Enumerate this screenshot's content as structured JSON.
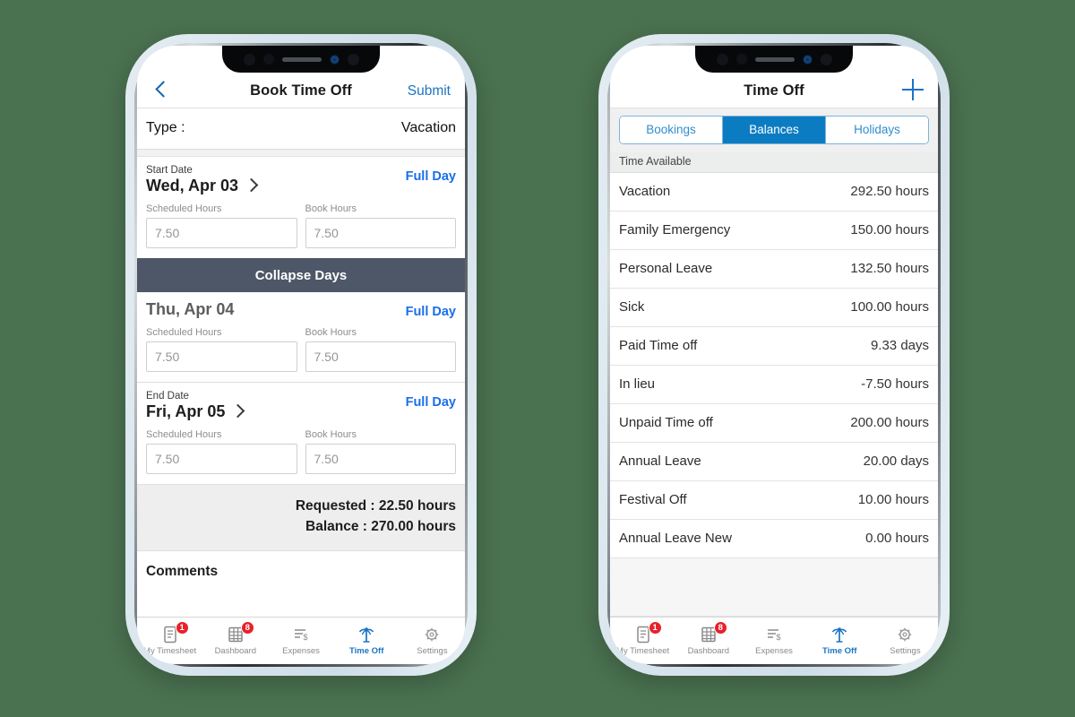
{
  "background_color": "#4a7150",
  "accent_blue": "#1a74c4",
  "link_blue": "#1a6ee8",
  "badge_red": "#e8202a",
  "collapse_bar_color": "#4e5767",
  "left_phone": {
    "appbar": {
      "back_icon": "chevron-left-icon",
      "title": "Book Time Off",
      "submit_label": "Submit"
    },
    "type_row": {
      "label": "Type :",
      "value": "Vacation"
    },
    "days": [
      {
        "caption": "Start Date",
        "date": "Wed, Apr 03",
        "has_chevron": true,
        "full_day_label": "Full Day",
        "scheduled_hours_label": "Scheduled Hours",
        "scheduled_hours_value": "7.50",
        "book_hours_label": "Book Hours",
        "book_hours_value": "7.50"
      },
      {
        "caption": "",
        "date": "Thu, Apr 04",
        "has_chevron": false,
        "full_day_label": "Full Day",
        "scheduled_hours_label": "Scheduled Hours",
        "scheduled_hours_value": "7.50",
        "book_hours_label": "Book Hours",
        "book_hours_value": "7.50"
      },
      {
        "caption": "End Date",
        "date": "Fri, Apr 05",
        "has_chevron": true,
        "full_day_label": "Full Day",
        "scheduled_hours_label": "Scheduled Hours",
        "scheduled_hours_value": "7.50",
        "book_hours_label": "Book Hours",
        "book_hours_value": "7.50"
      }
    ],
    "collapse_bar_label": "Collapse Days",
    "summary": {
      "requested": "Requested :  22.50 hours",
      "balance": "Balance :  270.00 hours"
    },
    "comments_label": "Comments"
  },
  "right_phone": {
    "appbar": {
      "title": "Time Off",
      "add_icon": "plus-icon"
    },
    "segments": [
      {
        "label": "Bookings",
        "active": false
      },
      {
        "label": "Balances",
        "active": true
      },
      {
        "label": "Holidays",
        "active": false
      }
    ],
    "list_header": "Time Available",
    "balances": [
      {
        "name": "Vacation",
        "value": "292.50 hours"
      },
      {
        "name": "Family Emergency",
        "value": "150.00 hours"
      },
      {
        "name": "Personal Leave",
        "value": "132.50 hours"
      },
      {
        "name": "Sick",
        "value": "100.00 hours"
      },
      {
        "name": "Paid Time off",
        "value": "9.33 days"
      },
      {
        "name": "In lieu",
        "value": "-7.50 hours"
      },
      {
        "name": "Unpaid Time off",
        "value": "200.00 hours"
      },
      {
        "name": "Annual Leave",
        "value": "20.00 days"
      },
      {
        "name": "Festival Off",
        "value": "10.00 hours"
      },
      {
        "name": "Annual Leave New",
        "value": "0.00 hours"
      }
    ]
  },
  "tabbar": [
    {
      "label": "My Timesheet",
      "icon": "document-icon",
      "badge": "1",
      "active": false
    },
    {
      "label": "Dashboard",
      "icon": "grid-table-icon",
      "badge": "8",
      "active": false
    },
    {
      "label": "Expenses",
      "icon": "expenses-dollar-icon",
      "badge": "",
      "active": false
    },
    {
      "label": "Time Off",
      "icon": "palm-tree-icon",
      "badge": "",
      "active": true
    },
    {
      "label": "Settings",
      "icon": "gear-icon",
      "badge": "",
      "active": false
    }
  ]
}
